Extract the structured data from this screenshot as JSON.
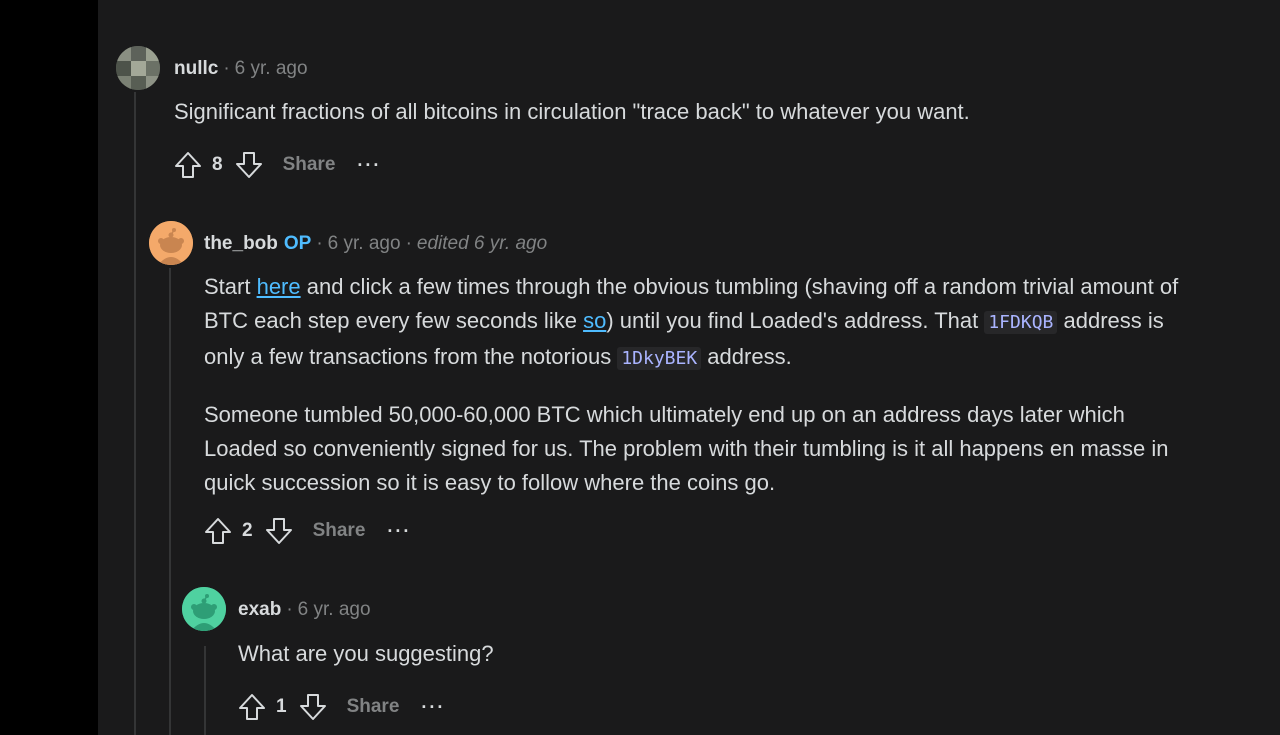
{
  "comments": [
    {
      "author": "nullc",
      "separator": "·",
      "time": "6 yr. ago",
      "text": "Significant fractions of all bitcoins in circulation \"trace back\" to whatever you want.",
      "score": "8",
      "share_label": "Share",
      "more_label": "···",
      "avatar_icon": "pixel-avatar-icon"
    },
    {
      "author": "the_bob",
      "op_badge": "OP",
      "separator": "·",
      "time": "6 yr. ago",
      "edited": "edited 6 yr. ago",
      "p1_a": "Start ",
      "p1_link1": "here",
      "p1_b": " and click a few times through the obvious tumbling (shaving off a random trivial amount of BTC each step every few seconds like ",
      "p1_link2": "so",
      "p1_c": ") until you find Loaded's address. That ",
      "p1_code1": "1FDKQB",
      "p1_d": " address is only a few transactions from the notorious ",
      "p1_code2": "1DkyBEK",
      "p1_e": " address.",
      "p2": "Someone tumbled 50,000-60,000 BTC which ultimately end up on an address days later which Loaded so conveniently signed for us. The problem with their tumbling is it all happens en masse in quick succession so it is easy to follow where the coins go.",
      "score": "2",
      "share_label": "Share",
      "more_label": "···",
      "avatar_color": "#f4a96a",
      "avatar_icon": "snoo-avatar-icon"
    },
    {
      "author": "exab",
      "separator": "·",
      "time": "6 yr. ago",
      "text": "What are you suggesting?",
      "score": "1",
      "share_label": "Share",
      "more_label": "···",
      "avatar_color": "#4fd1a0",
      "avatar_icon": "snoo-avatar-icon"
    }
  ]
}
